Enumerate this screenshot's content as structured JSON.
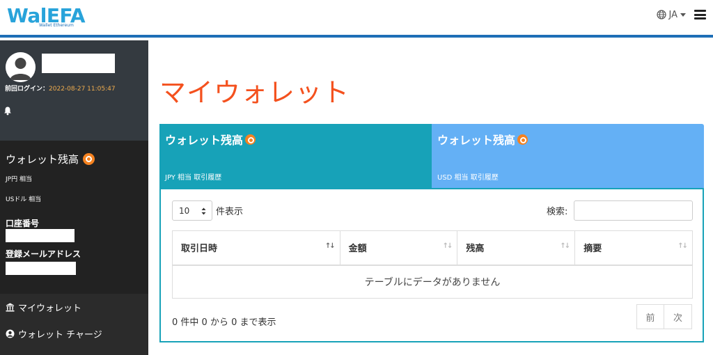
{
  "brand": {
    "logo_text": "WalEFA",
    "logo_sub": "Wallet Ethereum"
  },
  "topbar": {
    "language": "JA"
  },
  "user": {
    "last_login_label": "前回ログイン：",
    "last_login_time": "2022-08-27 11:05:47"
  },
  "sidebar": {
    "wallet_title": "ウォレット残高",
    "jpy_label": "JP円 相当",
    "usd_label": "USドル 相当",
    "account_label": "口座番号",
    "email_label": "登録メールアドレス",
    "nav": [
      {
        "label": "マイウォレット",
        "icon": "bank-icon"
      },
      {
        "label": "ウォレット チャージ",
        "icon": "user-charge-icon"
      }
    ]
  },
  "main": {
    "title": "マイウォレット",
    "tabs": [
      {
        "title": "ウォレット残高",
        "sub": "JPY 相当 取引履歴",
        "active": true
      },
      {
        "title": "ウォレット残高",
        "sub": "USD 相当 取引履歴",
        "active": false
      }
    ],
    "table": {
      "length_value": "10",
      "length_label": "件表示",
      "search_label": "検索:",
      "columns": [
        "取引日時",
        "金額",
        "残高",
        "摘要"
      ],
      "empty_message": "テーブルにデータがありません",
      "info": "0 件中 0 から 0 まで表示",
      "prev_label": "前",
      "next_label": "次"
    }
  },
  "colors": {
    "accent_blue": "#1e6fb6",
    "title_orange": "#f4511e",
    "tab_active": "#17a2b8",
    "tab_inactive": "#64b0f5",
    "timestamp": "#f0ad4e"
  }
}
